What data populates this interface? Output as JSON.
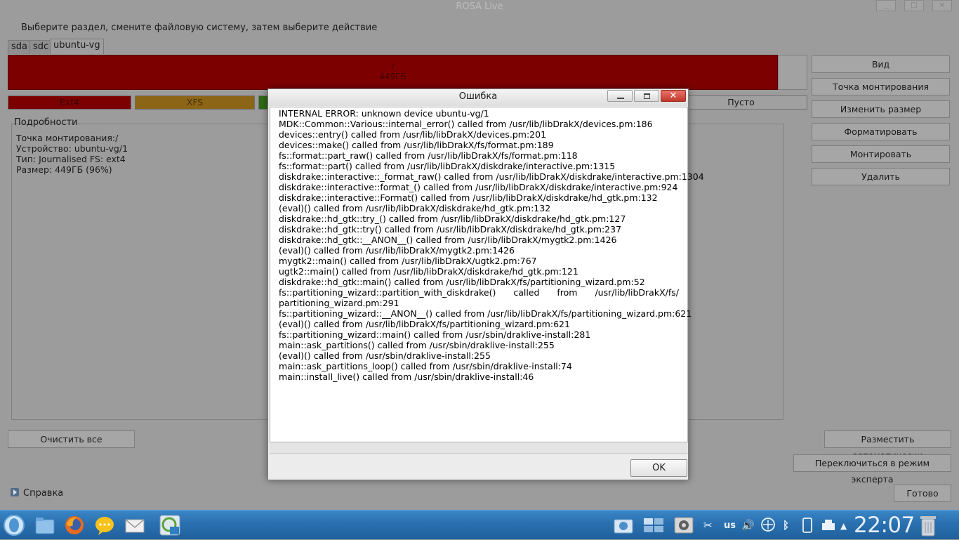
{
  "window": {
    "title": "ROSA Live"
  },
  "instruction": "Выберите раздел, смените файловую систему, затем выберите действие",
  "tabs": [
    {
      "label": "sda"
    },
    {
      "label": "sdc"
    },
    {
      "label": "ubuntu-vg"
    }
  ],
  "partition": {
    "mount": "/",
    "size": "449ГБ"
  },
  "legend": [
    {
      "label": "Ext4",
      "color": "#7d0000"
    },
    {
      "label": "XFS",
      "color": "#8c6616"
    },
    {
      "label": "Пусто",
      "color": "#a0a0a0"
    }
  ],
  "details": {
    "label": "Подробности",
    "lines": [
      "Точка монтирования:/",
      "Устройство: ubuntu-vg/1",
      "Тип: Journalised FS: ext4",
      "Размер: 449ГБ (96%)"
    ]
  },
  "actions": [
    "Вид",
    "Точка монтирования",
    "Изменить размер",
    "Форматировать",
    "Монтировать",
    "Удалить"
  ],
  "buttons": {
    "clear_all": "Очистить все",
    "auto_allocate": "Разместить автоматически",
    "expert_mode": "Переключиться в режим эксперта",
    "help": "Справка",
    "done": "Готово"
  },
  "dialog": {
    "title": "Ошибка",
    "ok": "OK",
    "lines": [
      "INTERNAL ERROR: unknown device ubuntu-vg/1",
      "MDK::Common::Various::internal_error() called from /usr/lib/libDrakX/devices.pm:186",
      "devices::entry() called from /usr/lib/libDrakX/devices.pm:201",
      "devices::make() called from /usr/lib/libDrakX/fs/format.pm:189",
      "fs::format::part_raw() called from /usr/lib/libDrakX/fs/format.pm:118",
      "fs::format::part() called from /usr/lib/libDrakX/diskdrake/interactive.pm:1315",
      "diskdrake::interactive::_format_raw() called from /usr/lib/libDrakX/diskdrake/interactive.pm:1304",
      "diskdrake::interactive::format_() called from /usr/lib/libDrakX/diskdrake/interactive.pm:924",
      "diskdrake::interactive::Format() called from /usr/lib/libDrakX/diskdrake/hd_gtk.pm:132",
      "(eval)() called from /usr/lib/libDrakX/diskdrake/hd_gtk.pm:132",
      "diskdrake::hd_gtk::try_() called from /usr/lib/libDrakX/diskdrake/hd_gtk.pm:127",
      "diskdrake::hd_gtk::try() called from /usr/lib/libDrakX/diskdrake/hd_gtk.pm:237",
      "diskdrake::hd_gtk::__ANON__() called from /usr/lib/libDrakX/mygtk2.pm:1426",
      "(eval)() called from /usr/lib/libDrakX/mygtk2.pm:1426",
      "mygtk2::main() called from /usr/lib/libDrakX/ugtk2.pm:767",
      "ugtk2::main() called from /usr/lib/libDrakX/diskdrake/hd_gtk.pm:121",
      "diskdrake::hd_gtk::main() called from /usr/lib/libDrakX/fs/partitioning_wizard.pm:52"
    ],
    "wrap_line": [
      "fs::partitioning_wizard::partition_with_diskdrake()",
      "called",
      "from",
      "/usr/lib/libDrakX/fs/"
    ],
    "lines2": [
      "partitioning_wizard.pm:291",
      "fs::partitioning_wizard::__ANON__() called from /usr/lib/libDrakX/fs/partitioning_wizard.pm:621",
      "(eval)() called from /usr/lib/libDrakX/fs/partitioning_wizard.pm:621",
      "fs::partitioning_wizard::main() called from /usr/sbin/draklive-install:281",
      "main::ask_partitions() called from /usr/sbin/draklive-install:255",
      "(eval)() called from /usr/sbin/draklive-install:255",
      "main::ask_partitions_loop() called from /usr/sbin/draklive-install:74",
      "main::install_live() called from /usr/sbin/draklive-install:46"
    ]
  },
  "taskbar": {
    "keyboard_layout": "us",
    "clock": "22:07"
  }
}
